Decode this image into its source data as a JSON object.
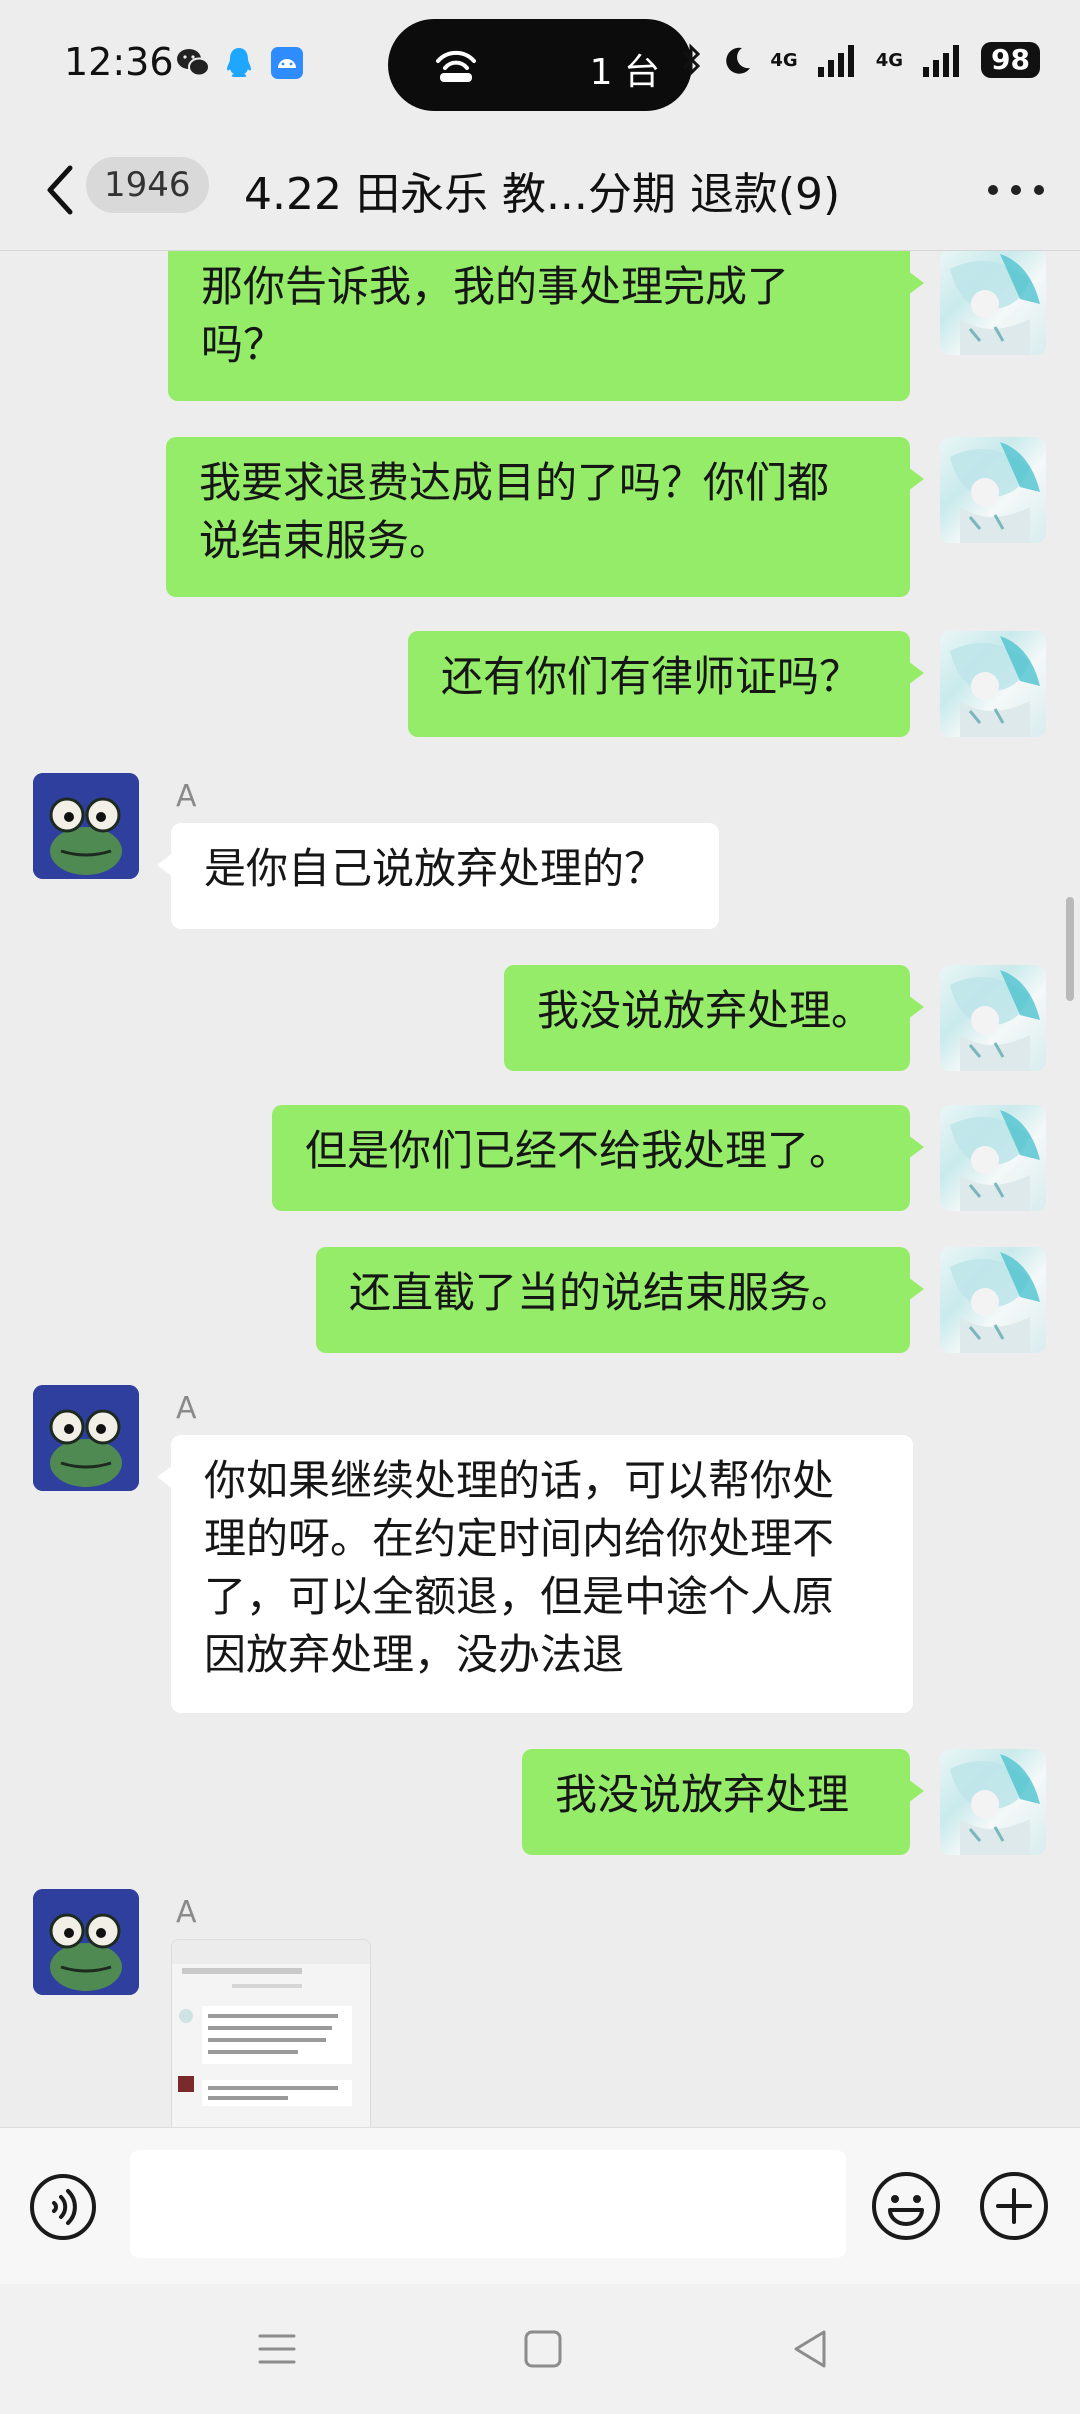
{
  "status_bar": {
    "time": "12:36",
    "island_count": "1 台",
    "battery": "98",
    "network": "4G"
  },
  "header": {
    "unread_count": "1946",
    "title": "4.22 田永乐 教...分期 退款(9)"
  },
  "messages": [
    {
      "side": "me",
      "lines": [
        "那你告诉我，我的事处理完成了",
        "吗？"
      ]
    },
    {
      "side": "me",
      "lines": [
        "我要求退费达成目的了吗？你们都",
        "说结束服务。"
      ]
    },
    {
      "side": "me",
      "lines": [
        "还有你们有律师证吗？"
      ]
    },
    {
      "side": "other",
      "sender": "A",
      "lines": [
        "是你自己说放弃处理的？"
      ]
    },
    {
      "side": "me",
      "lines": [
        "我没说放弃处理。"
      ]
    },
    {
      "side": "me",
      "lines": [
        "但是你们已经不给我处理了。"
      ]
    },
    {
      "side": "me",
      "lines": [
        "还直截了当的说结束服务。"
      ]
    },
    {
      "side": "other",
      "sender": "A",
      "lines": [
        "你如果继续处理的话，可以帮你处",
        "理的呀。在约定时间内给你处理不",
        "了，可以全额退，但是中途个人原",
        "因放弃处理，没办法退"
      ]
    },
    {
      "side": "me",
      "lines": [
        "我没说放弃处理"
      ]
    },
    {
      "side": "other",
      "sender": "A",
      "image": "screenshot-thumbnail"
    }
  ],
  "input": {
    "placeholder": ""
  },
  "icons": {
    "back": "chevron-left-icon",
    "more": "more-dots-icon",
    "voice": "voice-icon",
    "emoji": "emoji-icon",
    "plus": "plus-icon"
  },
  "colors": {
    "my_bubble": "#95ec69",
    "their_bubble": "#ffffff",
    "background": "#ededed"
  }
}
